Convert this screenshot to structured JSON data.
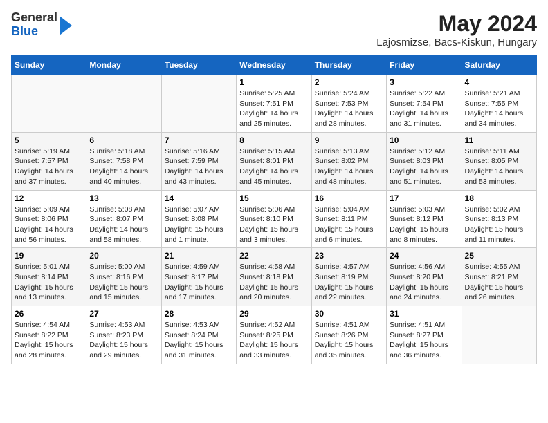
{
  "logo": {
    "general": "General",
    "blue": "Blue"
  },
  "title": "May 2024",
  "subtitle": "Lajosmizse, Bacs-Kiskun, Hungary",
  "headers": [
    "Sunday",
    "Monday",
    "Tuesday",
    "Wednesday",
    "Thursday",
    "Friday",
    "Saturday"
  ],
  "weeks": [
    [
      {
        "day": "",
        "info": ""
      },
      {
        "day": "",
        "info": ""
      },
      {
        "day": "",
        "info": ""
      },
      {
        "day": "1",
        "info": "Sunrise: 5:25 AM\nSunset: 7:51 PM\nDaylight: 14 hours and 25 minutes."
      },
      {
        "day": "2",
        "info": "Sunrise: 5:24 AM\nSunset: 7:53 PM\nDaylight: 14 hours and 28 minutes."
      },
      {
        "day": "3",
        "info": "Sunrise: 5:22 AM\nSunset: 7:54 PM\nDaylight: 14 hours and 31 minutes."
      },
      {
        "day": "4",
        "info": "Sunrise: 5:21 AM\nSunset: 7:55 PM\nDaylight: 14 hours and 34 minutes."
      }
    ],
    [
      {
        "day": "5",
        "info": "Sunrise: 5:19 AM\nSunset: 7:57 PM\nDaylight: 14 hours and 37 minutes."
      },
      {
        "day": "6",
        "info": "Sunrise: 5:18 AM\nSunset: 7:58 PM\nDaylight: 14 hours and 40 minutes."
      },
      {
        "day": "7",
        "info": "Sunrise: 5:16 AM\nSunset: 7:59 PM\nDaylight: 14 hours and 43 minutes."
      },
      {
        "day": "8",
        "info": "Sunrise: 5:15 AM\nSunset: 8:01 PM\nDaylight: 14 hours and 45 minutes."
      },
      {
        "day": "9",
        "info": "Sunrise: 5:13 AM\nSunset: 8:02 PM\nDaylight: 14 hours and 48 minutes."
      },
      {
        "day": "10",
        "info": "Sunrise: 5:12 AM\nSunset: 8:03 PM\nDaylight: 14 hours and 51 minutes."
      },
      {
        "day": "11",
        "info": "Sunrise: 5:11 AM\nSunset: 8:05 PM\nDaylight: 14 hours and 53 minutes."
      }
    ],
    [
      {
        "day": "12",
        "info": "Sunrise: 5:09 AM\nSunset: 8:06 PM\nDaylight: 14 hours and 56 minutes."
      },
      {
        "day": "13",
        "info": "Sunrise: 5:08 AM\nSunset: 8:07 PM\nDaylight: 14 hours and 58 minutes."
      },
      {
        "day": "14",
        "info": "Sunrise: 5:07 AM\nSunset: 8:08 PM\nDaylight: 15 hours and 1 minute."
      },
      {
        "day": "15",
        "info": "Sunrise: 5:06 AM\nSunset: 8:10 PM\nDaylight: 15 hours and 3 minutes."
      },
      {
        "day": "16",
        "info": "Sunrise: 5:04 AM\nSunset: 8:11 PM\nDaylight: 15 hours and 6 minutes."
      },
      {
        "day": "17",
        "info": "Sunrise: 5:03 AM\nSunset: 8:12 PM\nDaylight: 15 hours and 8 minutes."
      },
      {
        "day": "18",
        "info": "Sunrise: 5:02 AM\nSunset: 8:13 PM\nDaylight: 15 hours and 11 minutes."
      }
    ],
    [
      {
        "day": "19",
        "info": "Sunrise: 5:01 AM\nSunset: 8:14 PM\nDaylight: 15 hours and 13 minutes."
      },
      {
        "day": "20",
        "info": "Sunrise: 5:00 AM\nSunset: 8:16 PM\nDaylight: 15 hours and 15 minutes."
      },
      {
        "day": "21",
        "info": "Sunrise: 4:59 AM\nSunset: 8:17 PM\nDaylight: 15 hours and 17 minutes."
      },
      {
        "day": "22",
        "info": "Sunrise: 4:58 AM\nSunset: 8:18 PM\nDaylight: 15 hours and 20 minutes."
      },
      {
        "day": "23",
        "info": "Sunrise: 4:57 AM\nSunset: 8:19 PM\nDaylight: 15 hours and 22 minutes."
      },
      {
        "day": "24",
        "info": "Sunrise: 4:56 AM\nSunset: 8:20 PM\nDaylight: 15 hours and 24 minutes."
      },
      {
        "day": "25",
        "info": "Sunrise: 4:55 AM\nSunset: 8:21 PM\nDaylight: 15 hours and 26 minutes."
      }
    ],
    [
      {
        "day": "26",
        "info": "Sunrise: 4:54 AM\nSunset: 8:22 PM\nDaylight: 15 hours and 28 minutes."
      },
      {
        "day": "27",
        "info": "Sunrise: 4:53 AM\nSunset: 8:23 PM\nDaylight: 15 hours and 29 minutes."
      },
      {
        "day": "28",
        "info": "Sunrise: 4:53 AM\nSunset: 8:24 PM\nDaylight: 15 hours and 31 minutes."
      },
      {
        "day": "29",
        "info": "Sunrise: 4:52 AM\nSunset: 8:25 PM\nDaylight: 15 hours and 33 minutes."
      },
      {
        "day": "30",
        "info": "Sunrise: 4:51 AM\nSunset: 8:26 PM\nDaylight: 15 hours and 35 minutes."
      },
      {
        "day": "31",
        "info": "Sunrise: 4:51 AM\nSunset: 8:27 PM\nDaylight: 15 hours and 36 minutes."
      },
      {
        "day": "",
        "info": ""
      }
    ]
  ]
}
